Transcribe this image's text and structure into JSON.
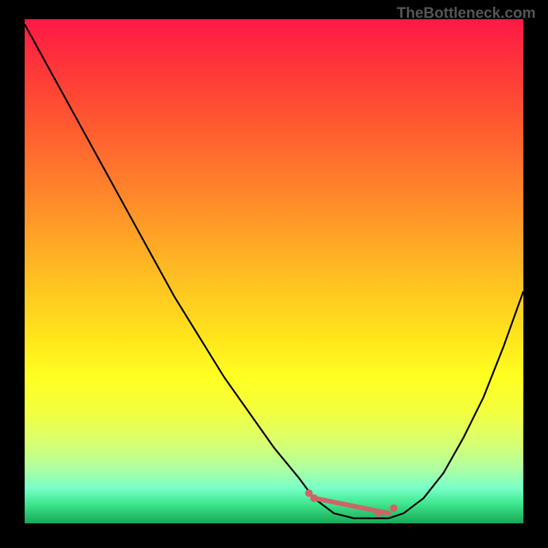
{
  "watermark": "TheBottleneck.com",
  "chart_data": {
    "type": "line",
    "title": "",
    "xlabel": "",
    "ylabel": "",
    "xlim": [
      0,
      100
    ],
    "ylim": [
      0,
      100
    ],
    "grid": false,
    "legend": false,
    "annotations": [],
    "series": [
      {
        "name": "bottleneck-curve",
        "x": [
          0,
          5,
          10,
          15,
          20,
          25,
          30,
          35,
          40,
          45,
          50,
          55,
          58,
          62,
          66,
          70,
          73,
          76,
          80,
          84,
          88,
          92,
          96,
          100
        ],
        "values": [
          99,
          90,
          81,
          72,
          63,
          54,
          45,
          37,
          29,
          22,
          15,
          9,
          5,
          2,
          1,
          1,
          1,
          2,
          5,
          10,
          17,
          25,
          35,
          46
        ]
      }
    ],
    "markers": [
      {
        "x": 57,
        "y": 6,
        "color": "#CC6666"
      },
      {
        "x": 58,
        "y": 5,
        "color": "#CC6666"
      },
      {
        "x": 71,
        "y": 2,
        "color": "#CC6666"
      },
      {
        "x": 74,
        "y": 3,
        "color": "#CC6666"
      }
    ],
    "marker_segment": {
      "x0": 58,
      "y0": 5,
      "x1": 73,
      "y1": 2,
      "color": "#CC6666"
    },
    "colors": {
      "curve": "#000000",
      "marker": "#CC6666",
      "gradient_stops": [
        {
          "pct": 0,
          "color": "#FF1846"
        },
        {
          "pct": 50,
          "color": "#FFCC20"
        },
        {
          "pct": 80,
          "color": "#FFFF30"
        },
        {
          "pct": 100,
          "color": "#18A858"
        }
      ]
    }
  }
}
